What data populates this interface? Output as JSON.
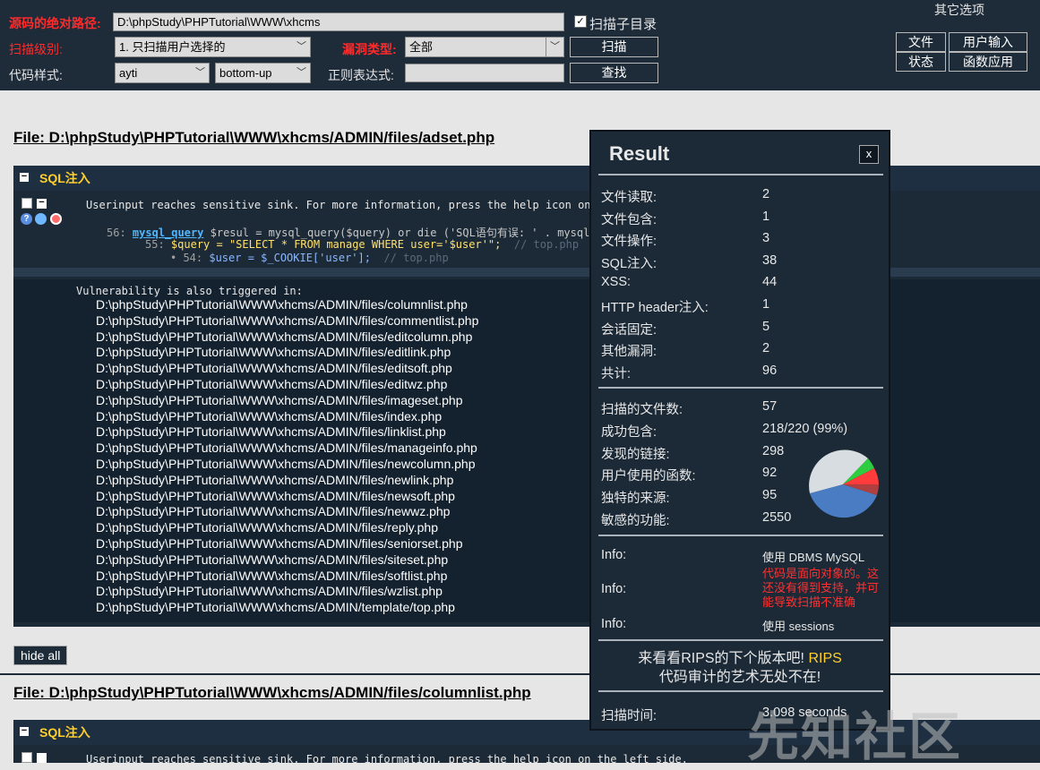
{
  "toolbar": {
    "path_label": "源码的绝对路径:",
    "path_value": "D:\\phpStudy\\PHPTutorial\\WWW\\xhcms",
    "subdir_label": "扫描子目录",
    "level_label": "扫描级别:",
    "level_value": "1. 只扫描用户选择的",
    "vuln_label": "漏洞类型:",
    "vuln_value": "全部",
    "scan_button": "扫描",
    "style_label": "代码样式:",
    "style_value": "ayti",
    "order_value": "bottom-up",
    "regex_label": "正则表达式:",
    "find_button": "查找",
    "other_options": "其它选项",
    "btn_file": "文件",
    "btn_userinput": "用户输入",
    "btn_status": "状态",
    "btn_functions": "函数应用"
  },
  "files": [
    {
      "header": "File: D:\\phpStudy\\PHPTutorial\\WWW\\xhcms/ADMIN/files/adset.php",
      "vuln_title": "SQL注入",
      "message": "Userinput reaches sensitive sink. For more information, press the help icon on the left side.",
      "line56_num": "56:",
      "line56_fn": "mysql_query",
      "line56_rest": " $resul = mysql_query($query) or die ('SQL语句有误: ' . mysql_error());",
      "line55_num": "55:",
      "line55_code": "$query = \"SELECT * FROM manage WHERE user='$user'\";",
      "line55_cmt": "// top.php",
      "line54_num": "• 54:",
      "line54_code": "$user = $_COOKIE['user'];",
      "line54_cmt": "// top.php",
      "also_title": "Vulnerability is also triggered in:",
      "also_list": [
        "D:\\phpStudy\\PHPTutorial\\WWW\\xhcms/ADMIN/files/columnlist.php",
        "D:\\phpStudy\\PHPTutorial\\WWW\\xhcms/ADMIN/files/commentlist.php",
        "D:\\phpStudy\\PHPTutorial\\WWW\\xhcms/ADMIN/files/editcolumn.php",
        "D:\\phpStudy\\PHPTutorial\\WWW\\xhcms/ADMIN/files/editlink.php",
        "D:\\phpStudy\\PHPTutorial\\WWW\\xhcms/ADMIN/files/editsoft.php",
        "D:\\phpStudy\\PHPTutorial\\WWW\\xhcms/ADMIN/files/editwz.php",
        "D:\\phpStudy\\PHPTutorial\\WWW\\xhcms/ADMIN/files/imageset.php",
        "D:\\phpStudy\\PHPTutorial\\WWW\\xhcms/ADMIN/files/index.php",
        "D:\\phpStudy\\PHPTutorial\\WWW\\xhcms/ADMIN/files/linklist.php",
        "D:\\phpStudy\\PHPTutorial\\WWW\\xhcms/ADMIN/files/manageinfo.php",
        "D:\\phpStudy\\PHPTutorial\\WWW\\xhcms/ADMIN/files/newcolumn.php",
        "D:\\phpStudy\\PHPTutorial\\WWW\\xhcms/ADMIN/files/newlink.php",
        "D:\\phpStudy\\PHPTutorial\\WWW\\xhcms/ADMIN/files/newsoft.php",
        "D:\\phpStudy\\PHPTutorial\\WWW\\xhcms/ADMIN/files/newwz.php",
        "D:\\phpStudy\\PHPTutorial\\WWW\\xhcms/ADMIN/files/reply.php",
        "D:\\phpStudy\\PHPTutorial\\WWW\\xhcms/ADMIN/files/seniorset.php",
        "D:\\phpStudy\\PHPTutorial\\WWW\\xhcms/ADMIN/files/siteset.php",
        "D:\\phpStudy\\PHPTutorial\\WWW\\xhcms/ADMIN/files/softlist.php",
        "D:\\phpStudy\\PHPTutorial\\WWW\\xhcms/ADMIN/files/wzlist.php",
        "D:\\phpStudy\\PHPTutorial\\WWW\\xhcms/ADMIN/template/top.php"
      ]
    },
    {
      "header": "File: D:\\phpStudy\\PHPTutorial\\WWW\\xhcms/ADMIN/files/columnlist.php",
      "vuln_title": "SQL注入",
      "message": "Userinput reaches sensitive sink. For more information, press the help icon on the left side."
    }
  ],
  "hide_all": "hide all",
  "result": {
    "title": "Result",
    "close": "x",
    "counts": [
      {
        "k": "文件读取:",
        "v": "2"
      },
      {
        "k": "文件包含:",
        "v": "1"
      },
      {
        "k": "文件操作:",
        "v": "3"
      },
      {
        "k": "SQL注入:",
        "v": "38"
      },
      {
        "k": "XSS:",
        "v": "44"
      },
      {
        "k": "HTTP header注入:",
        "v": "1"
      },
      {
        "k": "会话固定:",
        "v": "5"
      },
      {
        "k": "其他漏洞:",
        "v": "2"
      },
      {
        "k": "共计:",
        "v": "96"
      }
    ],
    "stats": [
      {
        "k": "扫描的文件数:",
        "v": "57"
      },
      {
        "k": "成功包含:",
        "v": "218/220 (99%)"
      },
      {
        "k": "发现的链接:",
        "v": "298"
      },
      {
        "k": "用户使用的函数:",
        "v": "92"
      },
      {
        "k": "独特的来源:",
        "v": "95"
      },
      {
        "k": "敏感的功能:",
        "v": "2550"
      }
    ],
    "pie_colors": [
      "#d8dde2",
      "#4a7cc4",
      "#ff3b3b",
      "#2ecc40",
      "#b04040"
    ],
    "info": [
      {
        "k": "Info:",
        "v": "使用 DBMS MySQL"
      },
      {
        "k": "Info:",
        "v": "代码是面向对象的。这还没有得到支持，并可能导致扫描不准确"
      },
      {
        "k": "Info:",
        "v": "使用 sessions"
      }
    ],
    "promo_line1": "来看看RIPS的下个版本吧!",
    "promo_rips": "RIPS",
    "promo_line2": "代码审计的艺术无处不在!",
    "time_label": "扫描时间:",
    "time_value": "3.098 seconds"
  },
  "watermark": "先知社区",
  "icons": [
    "file-icon",
    "minus-icon",
    "help-icon",
    "bug-icon",
    "target-icon",
    "check-icon",
    "chevron-down-icon"
  ]
}
